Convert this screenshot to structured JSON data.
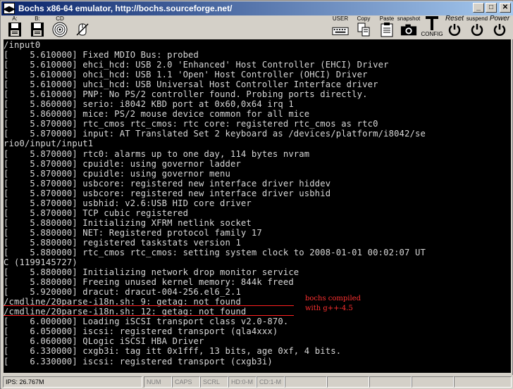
{
  "window": {
    "title": "Bochs x86-64 emulator, http://bochs.sourceforge.net/",
    "icon_glyph": "◀▶",
    "minimize_glyph": "_",
    "maximize_glyph": "□",
    "close_glyph": "✕"
  },
  "toolbar": {
    "left": [
      {
        "label": "A:",
        "icon": "floppy-a-icon",
        "glyph": "▣"
      },
      {
        "label": "B:",
        "icon": "floppy-b-icon",
        "glyph": "▣"
      },
      {
        "label": "CD",
        "icon": "cdrom-icon",
        "glyph": "◎"
      },
      {
        "label": "",
        "icon": "mouse-icon",
        "glyph": "⊘"
      }
    ],
    "right": [
      {
        "label": "USER",
        "icon": "keyboard-icon",
        "glyph": "⌨"
      },
      {
        "label": "Copy",
        "icon": "copy-icon",
        "glyph": "⎘"
      },
      {
        "label": "Paste",
        "icon": "paste-icon",
        "glyph": "📋"
      },
      {
        "label": "snapshot",
        "icon": "camera-icon",
        "glyph": "◙"
      },
      {
        "label": "CONFIG",
        "icon": "config-icon",
        "glyph": "T"
      },
      {
        "label": "Reset",
        "icon": "reset-icon",
        "glyph": "↻"
      },
      {
        "label": "suspend",
        "icon": "suspend-icon",
        "glyph": "⏻"
      },
      {
        "label": "Power",
        "icon": "power-icon",
        "glyph": "⏻"
      }
    ]
  },
  "console": {
    "lines": [
      "/input0",
      "[    5.610000] Fixed MDIO Bus: probed",
      "[    5.610000] ehci_hcd: USB 2.0 'Enhanced' Host Controller (EHCI) Driver",
      "[    5.610000] ohci_hcd: USB 1.1 'Open' Host Controller (OHCI) Driver",
      "[    5.610000] uhci_hcd: USB Universal Host Controller Interface driver",
      "[    5.610000] PNP: No PS/2 controller found. Probing ports directly.",
      "[    5.860000] serio: i8042 KBD port at 0x60,0x64 irq 1",
      "[    5.860000] mice: PS/2 mouse device common for all mice",
      "[    5.870000] rtc_cmos rtc_cmos: rtc core: registered rtc_cmos as rtc0",
      "[    5.870000] input: AT Translated Set 2 keyboard as /devices/platform/i8042/se",
      "rio0/input/input1",
      "[    5.870000] rtc0: alarms up to one day, 114 bytes nvram",
      "[    5.870000] cpuidle: using governor ladder",
      "[    5.870000] cpuidle: using governor menu",
      "[    5.870000] usbcore: registered new interface driver hiddev",
      "[    5.870000] usbcore: registered new interface driver usbhid",
      "[    5.870000] usbhid: v2.6:USB HID core driver",
      "[    5.870000] TCP cubic registered",
      "[    5.880000] Initializing XFRM netlink socket",
      "[    5.880000] NET: Registered protocol family 17",
      "[    5.880000] registered taskstats version 1",
      "[    5.880000] rtc_cmos rtc_cmos: setting system clock to 2008-01-01 00:02:07 UT",
      "C (1199145727)",
      "[    5.880000] Initializing network drop monitor service",
      "[    5.880000] Freeing unused kernel memory: 844k freed",
      "[    5.920000] dracut: dracut-004-256.el6_2.1",
      "/cmdline/20parse-i18n.sh: 9: getag: not found",
      "/cmdline/20parse-i18n.sh: 12: getag: not found",
      "[    6.000000] Loading iSCSI transport class v2.0-870.",
      "[    6.050000] iscsi: registered transport (qla4xxx)",
      "[    6.060000] QLogic iSCSI HBA Driver",
      "[    6.330000] cxgb3i: tag itt 0x1fff, 13 bits, age 0xf, 4 bits.",
      "[    6.330000] iscsi: registered transport (cxgb3i)",
      "_"
    ],
    "annotation": [
      "bochs compiled",
      "with g++-4.5"
    ],
    "annotation_color": "#ff3030"
  },
  "statusbar": {
    "ips": "IPS: 26.767M",
    "num": "NUM",
    "caps": "CAPS",
    "scrl": "SCRL",
    "hd": "HD:0-M",
    "cd": "CD:1-M"
  }
}
